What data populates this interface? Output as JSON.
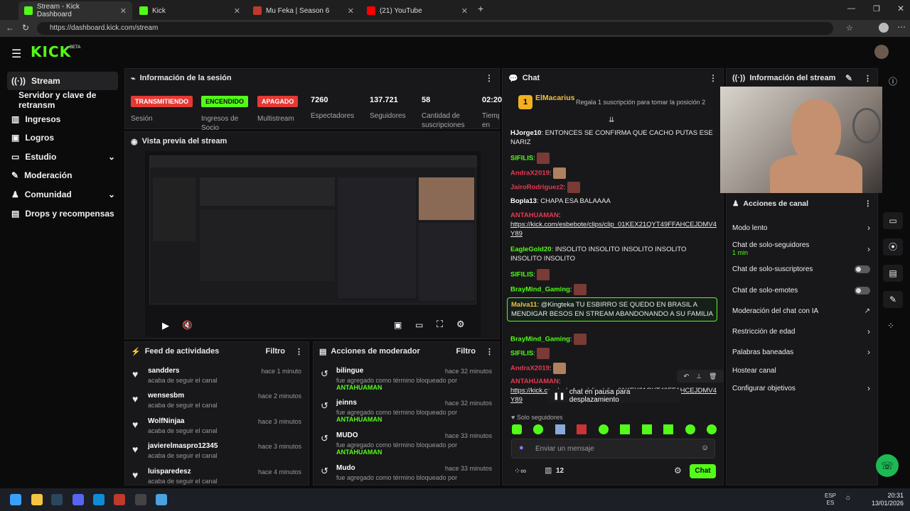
{
  "browser": {
    "tabs": [
      {
        "label": "Stream - Kick Dashboard",
        "color": "#53fc18"
      },
      {
        "label": "Kick",
        "color": "#53fc18"
      },
      {
        "label": "Mu Feka | Season 6",
        "color": "#c0392b"
      },
      {
        "label": "(21) YouTube",
        "color": "#ff0000"
      }
    ],
    "url": "https://dashboard.kick.com/stream"
  },
  "logo": "KICK",
  "logo_badge": "BETA",
  "sidebar": {
    "items": [
      {
        "label": "Stream",
        "icon": "stream-icon"
      },
      {
        "label": "Servidor y clave de retransm",
        "icon": ""
      },
      {
        "label": "Ingresos",
        "icon": "bank-icon"
      },
      {
        "label": "Logros",
        "icon": "trophy-icon"
      },
      {
        "label": "Estudio",
        "icon": "monitor-icon"
      },
      {
        "label": "Moderación",
        "icon": "wrench-icon"
      },
      {
        "label": "Comunidad",
        "icon": "people-icon"
      },
      {
        "label": "Drops y recompensas",
        "icon": "chart-icon"
      }
    ]
  },
  "session": {
    "title": "Información de la sesión",
    "badges": [
      {
        "text": "TRANSMITIENDO",
        "label": "Sesión",
        "color": "#e53935"
      },
      {
        "text": "ENCENDIDO",
        "label": "Ingresos de Socio",
        "color": "#53fc18"
      },
      {
        "text": "APAGADO",
        "label": "Multistream",
        "color": "#e53935"
      }
    ],
    "stats": [
      {
        "value": "7260",
        "label": "Espectadores"
      },
      {
        "value": "137.721",
        "label": "Seguidores"
      },
      {
        "value": "58",
        "label": "Cantidad de suscripciones"
      },
      {
        "value": "02:20",
        "label": "Tiempo en vivo"
      }
    ]
  },
  "preview": {
    "title": "Vista previa del stream"
  },
  "feed": {
    "title": "Feed de actividades",
    "filter": "Filtro",
    "items": [
      {
        "name": "sandders",
        "sub": "acaba de seguir el canal",
        "time": "hace 1 minuto"
      },
      {
        "name": "wensesbm",
        "sub": "acaba de seguir el canal",
        "time": "hace 2 minutos"
      },
      {
        "name": "WolfNinjaa",
        "sub": "acaba de seguir el canal",
        "time": "hace 3 minutos"
      },
      {
        "name": "javierelmaspro12345",
        "sub": "acaba de seguir el canal",
        "time": "hace 3 minutos"
      },
      {
        "name": "luisparedesz",
        "sub": "acaba de seguir el canal",
        "time": "hace 4 minutos"
      }
    ]
  },
  "modactions": {
    "title": "Acciones de moderador",
    "filter": "Filtro",
    "items": [
      {
        "name": "bilingue",
        "sub": "fue agregado como término bloqueado por",
        "by": "ANTAHUAMAN",
        "time": "hace 32 minutos"
      },
      {
        "name": "jeinns",
        "sub": "fue agregado como término bloqueado por",
        "by": "ANTAHUAMAN",
        "time": "hace 32 minutos"
      },
      {
        "name": "MUDO",
        "sub": "fue agregado como término bloqueado por",
        "by": "ANTAHUAMAN",
        "time": "hace 33 minutos"
      },
      {
        "name": "Mudo",
        "sub": "fue agregado como término bloqueado por",
        "by": "ANTAHUAMAN",
        "time": "hace 33 minutos"
      }
    ]
  },
  "chat": {
    "title": "Chat",
    "pinned_user": "ElMacarius",
    "pinned_count": "1",
    "gift_text": "Regala 1 suscripción para tomar la posición 2",
    "messages": [
      {
        "user": "HJorge10",
        "color": "#ffffff",
        "text": "ENTONCES SE CONFIRMA QUE CACHO PUTAS ESE NARIZ"
      },
      {
        "user": "SIFILIS",
        "color": "#53fc18",
        "text": ""
      },
      {
        "user": "AndraX2019",
        "color": "#e53950",
        "text": ""
      },
      {
        "user": "JairoRodriguez2",
        "color": "#e53950",
        "text": ""
      },
      {
        "user": "Bopla13",
        "color": "#ffffff",
        "text": "CHAPA ESA BALAAAA"
      },
      {
        "user": "ANTAHUAMAN",
        "color": "#e53950",
        "text": "https://kick.com/esbebote/clips/clip_01KEX21QYT49FFAHCEJDMV4Y89"
      },
      {
        "user": "EagleGold20",
        "color": "#53fc18",
        "text": "INSOLITO  INSOLITO  INSOLITO  INSOLITO  INSOLITO  INSOLITO"
      },
      {
        "user": "SIFILIS",
        "color": "#53fc18",
        "text": ""
      },
      {
        "user": "BrayMind_Gaming",
        "color": "#53fc18",
        "text": ""
      },
      {
        "user": "Malva11",
        "color": "#f0c040",
        "text": "@Kingteka TU ESBIRRO SE QUEDO EN BRASIL A MENDIGAR BESOS EN STREAM ABANDONANDO A SU FAMILIA"
      },
      {
        "user": "BrayMind_Gaming",
        "color": "#53fc18",
        "text": ""
      },
      {
        "user": "SIFILIS",
        "color": "#53fc18",
        "text": ""
      },
      {
        "user": "AndraX2019",
        "color": "#e53950",
        "text": ""
      },
      {
        "user": "ANTAHUAMAN",
        "color": "#e53950",
        "text": "https://kick.com/esbebote/clips/clip_01KEX21QYT49FFAHCEJDMV4Y89"
      }
    ],
    "paused": "chat en pausa para desplazamiento",
    "followers_only": "Solo seguidores",
    "input_placeholder": "Enviar un mensaje",
    "viewers_count": "12",
    "send_label": "Chat"
  },
  "stream_info": {
    "title": "Información del stream"
  },
  "channel_actions": {
    "title": "Acciones de canal",
    "items": [
      {
        "label": "Modo lento",
        "sub": "",
        "control": "chevron"
      },
      {
        "label": "Chat de solo-seguidores",
        "sub": "1 min",
        "control": "chevron"
      },
      {
        "label": "Chat de solo-suscriptores",
        "sub": "",
        "control": "toggle"
      },
      {
        "label": "Chat de solo-emotes",
        "sub": "",
        "control": "toggle"
      },
      {
        "label": "Moderación del chat con IA",
        "sub": "",
        "control": "external"
      },
      {
        "label": "Restricción de edad",
        "sub": "",
        "control": "chevron"
      },
      {
        "label": "Palabras baneadas",
        "sub": "",
        "control": "chevron"
      },
      {
        "label": "Hostear canal",
        "sub": "",
        "control": "none"
      },
      {
        "label": "Configurar objetivos",
        "sub": "",
        "control": "chevron"
      }
    ]
  },
  "taskbar": {
    "lang": "ESP",
    "lang2": "ES",
    "time": "20:31",
    "date": "13/01/2026"
  }
}
